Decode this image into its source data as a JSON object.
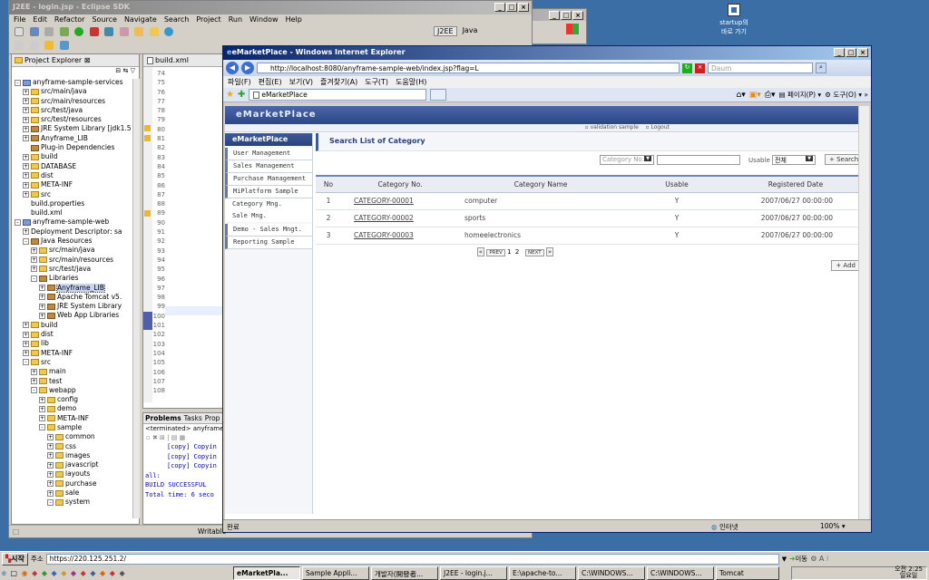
{
  "desktop": {
    "icon_label": "startup의\n바로 가기"
  },
  "eclipse": {
    "title": "J2EE - login.jsp - Eclipse SDK",
    "menu": [
      "File",
      "Edit",
      "Refactor",
      "Source",
      "Navigate",
      "Search",
      "Project",
      "Run",
      "Window",
      "Help"
    ],
    "perspectives": [
      "J2EE",
      "Java"
    ],
    "explorer_title": "Project Explorer",
    "editor_tabs": [
      "build.xml"
    ],
    "tree": [
      {
        "lvl": 0,
        "pm": "-",
        "ic": "proj",
        "t": "anyframe-sample-services"
      },
      {
        "lvl": 1,
        "pm": "+",
        "ic": "fold",
        "t": "src/main/java"
      },
      {
        "lvl": 1,
        "pm": "+",
        "ic": "fold",
        "t": "src/main/resources"
      },
      {
        "lvl": 1,
        "pm": "+",
        "ic": "fold",
        "t": "src/test/java"
      },
      {
        "lvl": 1,
        "pm": "+",
        "ic": "fold",
        "t": "src/test/resources"
      },
      {
        "lvl": 1,
        "pm": "+",
        "ic": "jar",
        "t": "JRE System Library [jdk1.5"
      },
      {
        "lvl": 1,
        "pm": "+",
        "ic": "jar",
        "t": "Anyframe_LIB"
      },
      {
        "lvl": 1,
        "pm": "",
        "ic": "jar",
        "t": "Plug-in Dependencies"
      },
      {
        "lvl": 1,
        "pm": "+",
        "ic": "fold",
        "t": "build"
      },
      {
        "lvl": 1,
        "pm": "+",
        "ic": "fold",
        "t": "DATABASE"
      },
      {
        "lvl": 1,
        "pm": "+",
        "ic": "fold",
        "t": "dist"
      },
      {
        "lvl": 1,
        "pm": "+",
        "ic": "fold",
        "t": "META-INF"
      },
      {
        "lvl": 1,
        "pm": "+",
        "ic": "fold",
        "t": "src"
      },
      {
        "lvl": 1,
        "pm": "",
        "ic": "file",
        "t": "build.properties"
      },
      {
        "lvl": 1,
        "pm": "",
        "ic": "file",
        "t": "build.xml"
      },
      {
        "lvl": 0,
        "pm": "-",
        "ic": "proj",
        "t": "anyframe-sample-web"
      },
      {
        "lvl": 1,
        "pm": "+",
        "ic": "file",
        "t": "Deployment Descriptor: sa"
      },
      {
        "lvl": 1,
        "pm": "-",
        "ic": "jar",
        "t": "Java Resources"
      },
      {
        "lvl": 2,
        "pm": "+",
        "ic": "fold",
        "t": "src/main/java"
      },
      {
        "lvl": 2,
        "pm": "+",
        "ic": "fold",
        "t": "src/main/resources"
      },
      {
        "lvl": 2,
        "pm": "+",
        "ic": "fold",
        "t": "src/test/java"
      },
      {
        "lvl": 2,
        "pm": "-",
        "ic": "jar",
        "t": "Libraries"
      },
      {
        "lvl": 3,
        "pm": "+",
        "ic": "jar",
        "t": "Anyframe_LIB",
        "sel": true
      },
      {
        "lvl": 3,
        "pm": "+",
        "ic": "jar",
        "t": "Apache Tomcat v5."
      },
      {
        "lvl": 3,
        "pm": "+",
        "ic": "jar",
        "t": "JRE System Library"
      },
      {
        "lvl": 3,
        "pm": "+",
        "ic": "jar",
        "t": "Web App Libraries"
      },
      {
        "lvl": 1,
        "pm": "+",
        "ic": "fold",
        "t": "build"
      },
      {
        "lvl": 1,
        "pm": "+",
        "ic": "fold",
        "t": "dist"
      },
      {
        "lvl": 1,
        "pm": "+",
        "ic": "fold",
        "t": "lib"
      },
      {
        "lvl": 1,
        "pm": "+",
        "ic": "fold",
        "t": "META-INF"
      },
      {
        "lvl": 1,
        "pm": "-",
        "ic": "fold",
        "t": "src"
      },
      {
        "lvl": 2,
        "pm": "+",
        "ic": "fold",
        "t": "main"
      },
      {
        "lvl": 2,
        "pm": "+",
        "ic": "fold",
        "t": "test"
      },
      {
        "lvl": 2,
        "pm": "-",
        "ic": "fold",
        "t": "webapp"
      },
      {
        "lvl": 3,
        "pm": "+",
        "ic": "fold",
        "t": "config"
      },
      {
        "lvl": 3,
        "pm": "+",
        "ic": "fold",
        "t": "demo"
      },
      {
        "lvl": 3,
        "pm": "+",
        "ic": "fold",
        "t": "META-INF"
      },
      {
        "lvl": 3,
        "pm": "-",
        "ic": "fold",
        "t": "sample"
      },
      {
        "lvl": 4,
        "pm": "+",
        "ic": "fold",
        "t": "common"
      },
      {
        "lvl": 4,
        "pm": "+",
        "ic": "fold",
        "t": "css"
      },
      {
        "lvl": 4,
        "pm": "+",
        "ic": "fold",
        "t": "images"
      },
      {
        "lvl": 4,
        "pm": "+",
        "ic": "fold",
        "t": "javascript"
      },
      {
        "lvl": 4,
        "pm": "+",
        "ic": "fold",
        "t": "layouts"
      },
      {
        "lvl": 4,
        "pm": "+",
        "ic": "fold",
        "t": "purchase"
      },
      {
        "lvl": 4,
        "pm": "+",
        "ic": "fold",
        "t": "sale"
      },
      {
        "lvl": 4,
        "pm": "-",
        "ic": "fold",
        "t": "system"
      }
    ],
    "line_numbers": [
      "74",
      "75",
      "76",
      "77",
      "78",
      "79",
      "80",
      "81",
      "82",
      "83",
      "84",
      "85",
      "86",
      "87",
      "88",
      "89",
      "90",
      "91",
      "92",
      "93",
      "94",
      "95",
      "96",
      "97",
      "98",
      "99",
      "100",
      "101",
      "102",
      "103",
      "104",
      "105",
      "106",
      "107",
      "108"
    ],
    "bottom_tabs": [
      "Problems",
      "Tasks",
      "Prop"
    ],
    "console_header": "<terminated> anyframe-",
    "console_lines": [
      "[copy] Copyin",
      "[copy] Copyin",
      "[copy] Copyin",
      "all:",
      "BUILD SUCCESSFUL",
      "Total time: 6 seco"
    ],
    "status": "Writable"
  },
  "ie": {
    "title": "eMarketPlace - Windows Internet Explorer",
    "url": "http://localhost:8080/anyframe-sample-web/index.jsp?flag=L",
    "search_placeholder": "Daum",
    "menu": [
      "파일(F)",
      "편집(E)",
      "보기(V)",
      "즐겨찾기(A)",
      "도구(T)",
      "도움말(H)"
    ],
    "tab": "eMarketPlace",
    "cmd_page": "페이지(P)",
    "cmd_tools": "도구(O)",
    "status_left": "완료",
    "status_zone": "인터넷",
    "zoom": "100%"
  },
  "app": {
    "brand": "eMarketPlace",
    "top_links": [
      "validation sample",
      "Logout"
    ],
    "side_title": "eMarketPlace",
    "side_items": [
      "User Management",
      "Sales Management",
      "Purchase Management",
      "MiPlatform Sample"
    ],
    "side_sub": [
      "Category Mng.",
      "Sale Mng."
    ],
    "side_items2": [
      "Demo - Sales Mngt.",
      "Reporting Sample"
    ],
    "page_title": "Search List of Category",
    "search_select": "Category No.",
    "usable_label": "Usable",
    "usable_select": "전체",
    "search_btn": "+ Search",
    "columns": [
      "No",
      "Category No.",
      "Category Name",
      "Usable",
      "Registered Date"
    ],
    "rows": [
      [
        "1",
        "CATEGORY-00001",
        "computer",
        "Y",
        "2007/06/27 00:00:00"
      ],
      [
        "2",
        "CATEGORY-00002",
        "sports",
        "Y",
        "2007/06/27 00:00:00"
      ],
      [
        "3",
        "CATEGORY-00003",
        "homeelectronics",
        "Y",
        "2007/06/27 00:00:00"
      ]
    ],
    "pager_prev": "PREV",
    "pager_pages": [
      "1",
      "2"
    ],
    "pager_next": "NEXT",
    "add_btn": "+ Add"
  },
  "taskbar": {
    "start": "시작",
    "address_label": "주소",
    "address": "https://220.125.251.2/",
    "go": "이동",
    "tasks": [
      "eMarketPla...",
      "Sample Appli...",
      "개발자(開發者...",
      "J2EE - login.j...",
      "E:\\apache-to...",
      "C:\\WINDOWS...",
      "C:\\WINDOWS...",
      "Tomcat"
    ],
    "clock": "오전 2:25",
    "day": "일요일"
  },
  "bg_window": {
    "title": ""
  }
}
